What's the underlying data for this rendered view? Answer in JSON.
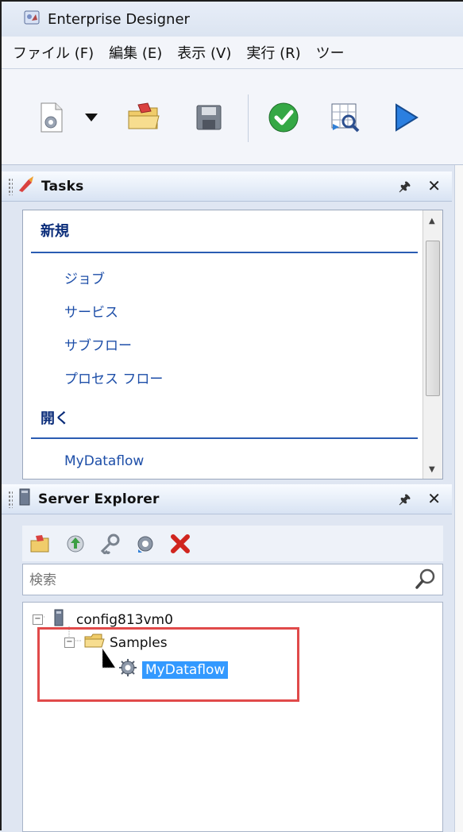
{
  "app": {
    "title": "Enterprise Designer"
  },
  "menu": [
    "ファイル (F)",
    "編集 (E)",
    "表示 (V)",
    "実行 (R)",
    "ツー"
  ],
  "toolbar": {
    "items": [
      "new-document-icon",
      "dropdown-arrow-icon",
      "open-folder-icon",
      "save-disk-icon",
      "validate-check-icon",
      "inspect-grid-icon",
      "run-play-icon"
    ]
  },
  "tasks": {
    "title": "Tasks",
    "pin": "⼀",
    "close": "✕",
    "sections": [
      {
        "title": "新規",
        "items": [
          "ジョブ",
          "サービス",
          "サブフロー",
          "プロセス フロー"
        ]
      },
      {
        "title": "開く",
        "items": [
          "MyDataflow"
        ]
      }
    ]
  },
  "server_explorer": {
    "title": "Server Explorer",
    "pin": "⼀",
    "close": "✕",
    "tools": [
      "open-icon",
      "upload-icon",
      "key-icon",
      "settings-icon",
      "delete-icon"
    ],
    "search_placeholder": "検索",
    "tree": {
      "root": "config813vm0",
      "folder": "Samples",
      "leaf": "MyDataflow"
    }
  },
  "colors": {
    "accent": "#2a5cb2",
    "selection": "#3399ff",
    "highlight": "#e04a4a"
  }
}
